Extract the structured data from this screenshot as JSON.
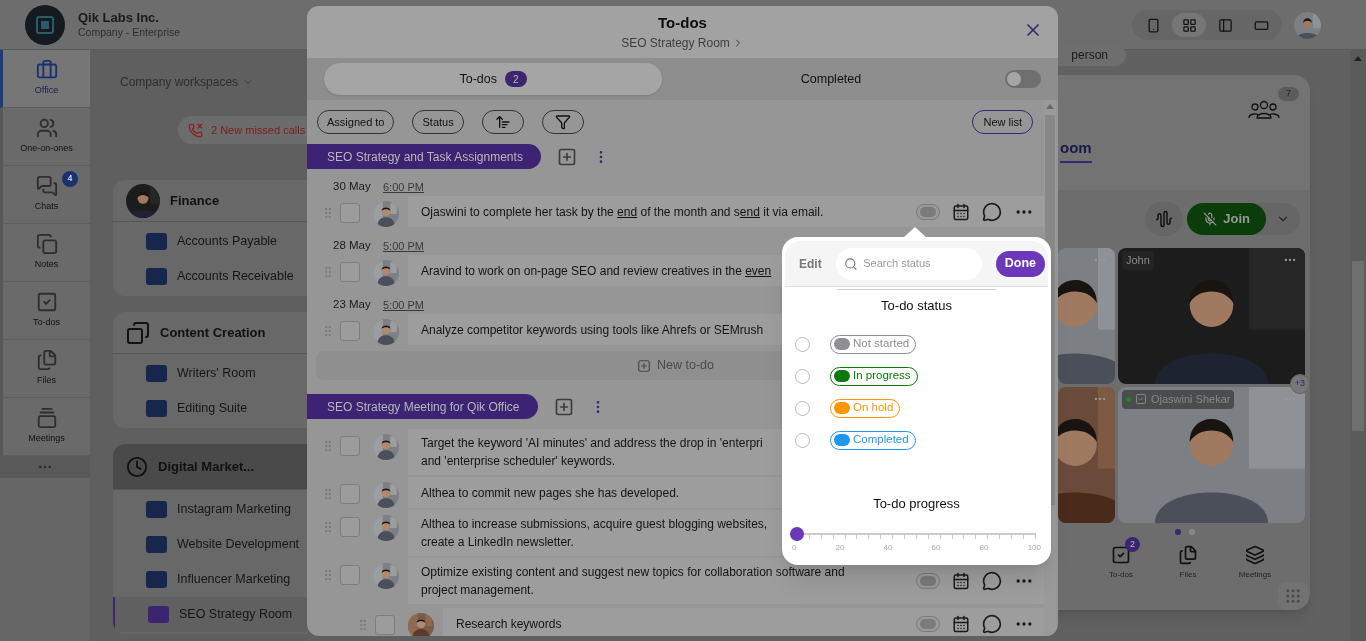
{
  "company": {
    "name": "Qik Labs Inc.",
    "plan": "Company - Enterprise"
  },
  "nav": [
    {
      "label": "Office",
      "selected": true
    },
    {
      "label": "One-on-ones",
      "selected": false
    },
    {
      "label": "Chats",
      "selected": false,
      "badge": "4"
    },
    {
      "label": "Notes",
      "selected": false
    },
    {
      "label": "To-dos",
      "selected": false
    },
    {
      "label": "Files",
      "selected": false
    },
    {
      "label": "Meetings",
      "selected": false
    }
  ],
  "workspaces": {
    "dropdown": "Company workspaces",
    "missed_calls": "2 New missed calls",
    "groups": [
      {
        "title": "Finance",
        "kind": "avatar",
        "selected": false,
        "rooms": [
          {
            "name": "Accounts Payable",
            "selected": false
          },
          {
            "name": "Accounts Receivable",
            "selected": false
          }
        ]
      },
      {
        "title": "Content Creation",
        "kind": "folders",
        "selected": false,
        "rooms": [
          {
            "name": "Writers' Room",
            "selected": false
          },
          {
            "name": "Editing Suite",
            "selected": false
          }
        ]
      },
      {
        "title": "Digital Market...",
        "kind": "clock",
        "selected": true,
        "rooms": [
          {
            "name": "Instagram Marketing",
            "selected": false
          },
          {
            "name": "Website Development",
            "selected": false
          },
          {
            "name": "Influencer Marketing",
            "selected": false
          },
          {
            "name": "SEO Strategy Room",
            "selected": true
          }
        ]
      }
    ]
  },
  "modal": {
    "title": "To-dos",
    "subtitle": "SEO Strategy Room",
    "tabs": [
      {
        "label": "To-dos",
        "count": "2",
        "selected": true
      },
      {
        "label": "Completed",
        "selected": false
      }
    ],
    "completed_toggle": {
      "on": false
    },
    "filters": [
      "Assigned to",
      "Status"
    ],
    "new_list": "New list",
    "new_todo": "New to-do",
    "lists": [
      {
        "title": "SEO Strategy and Task Assignments",
        "items": [
          {
            "date": "30 May",
            "time": "6:00 PM",
            "checked": false,
            "show_actions": true,
            "parts": [
              {
                "text": "Ojaswini to complete her task by the ",
                "underline": false
              },
              {
                "text": "end",
                "underline": true
              },
              {
                "text": " of the month and s",
                "underline": false
              },
              {
                "text": "end",
                "underline": true
              },
              {
                "text": " it via email.",
                "underline": false
              }
            ]
          },
          {
            "date": "28 May",
            "time": "5:00 PM",
            "checked": false,
            "parts": [
              {
                "text": "Aravind to work on on-page SEO and review creatives in the ",
                "underline": false
              },
              {
                "text": "even",
                "underline": true
              }
            ]
          },
          {
            "date": "23 May",
            "time": "5:00 PM",
            "checked": false,
            "parts": [
              {
                "text": "Analyze competitor keywords using tools like Ahrefs or SEMrush",
                "underline": false
              }
            ]
          }
        ]
      },
      {
        "title": "SEO Strategy Meeting for Qik Office",
        "items": [
          {
            "checked": false,
            "lines": [
              "Target the keyword 'AI minutes' and address the drop in 'enterpri",
              "and 'enterprise scheduler' keywords."
            ]
          },
          {
            "checked": false,
            "lines": [
              "Althea to commit new pages she has developed."
            ]
          },
          {
            "checked": false,
            "lines": [
              "Althea to increase submissions, acquire guest blogging websites,",
              "create a LinkedIn newsletter."
            ]
          },
          {
            "checked": false,
            "show_actions": true,
            "lines": [
              "Optimize existing content and suggest new topics for collaboration software and",
              "project management."
            ],
            "children": [
              {
                "checked": false,
                "show_actions": true,
                "lines": [
                  "Research keywords"
                ]
              }
            ]
          }
        ]
      }
    ]
  },
  "popover": {
    "edit": "Edit",
    "search_placeholder": "Search status",
    "done": "Done",
    "status_title": "To-do status",
    "statuses": [
      {
        "label": "Not started",
        "color": "#8e8e93",
        "selected": false
      },
      {
        "label": "In progress",
        "color": "#0b7a0b",
        "selected": false
      },
      {
        "label": "On hold",
        "color": "#ff9500",
        "selected": false
      },
      {
        "label": "Completed",
        "color": "#2196f3",
        "selected": false
      }
    ],
    "progress_title": "To-do progress",
    "progress": {
      "level": 0,
      "ticks": [
        "0",
        "20",
        "40",
        "60",
        "80",
        "100"
      ]
    }
  },
  "right": {
    "chip": "person",
    "room_title": "oom",
    "participants": "7",
    "join": "Join",
    "more_count": "+3",
    "view_modes": [
      {
        "selected": false
      },
      {
        "selected": true
      },
      {
        "selected": false
      },
      {
        "selected": false
      }
    ],
    "tiles": [
      {
        "kind": "picture"
      },
      {
        "kind": "picture",
        "name": "John"
      },
      {
        "kind": "picture"
      },
      {
        "kind": "picture",
        "name": "Ojaswini Shekar",
        "online": true
      }
    ],
    "pages": [
      {
        "selected": true
      },
      {
        "selected": false
      }
    ],
    "bottom_nav": [
      {
        "label": "To-dos",
        "badge": "2"
      },
      {
        "label": "Files"
      },
      {
        "label": "Meetings"
      }
    ]
  }
}
